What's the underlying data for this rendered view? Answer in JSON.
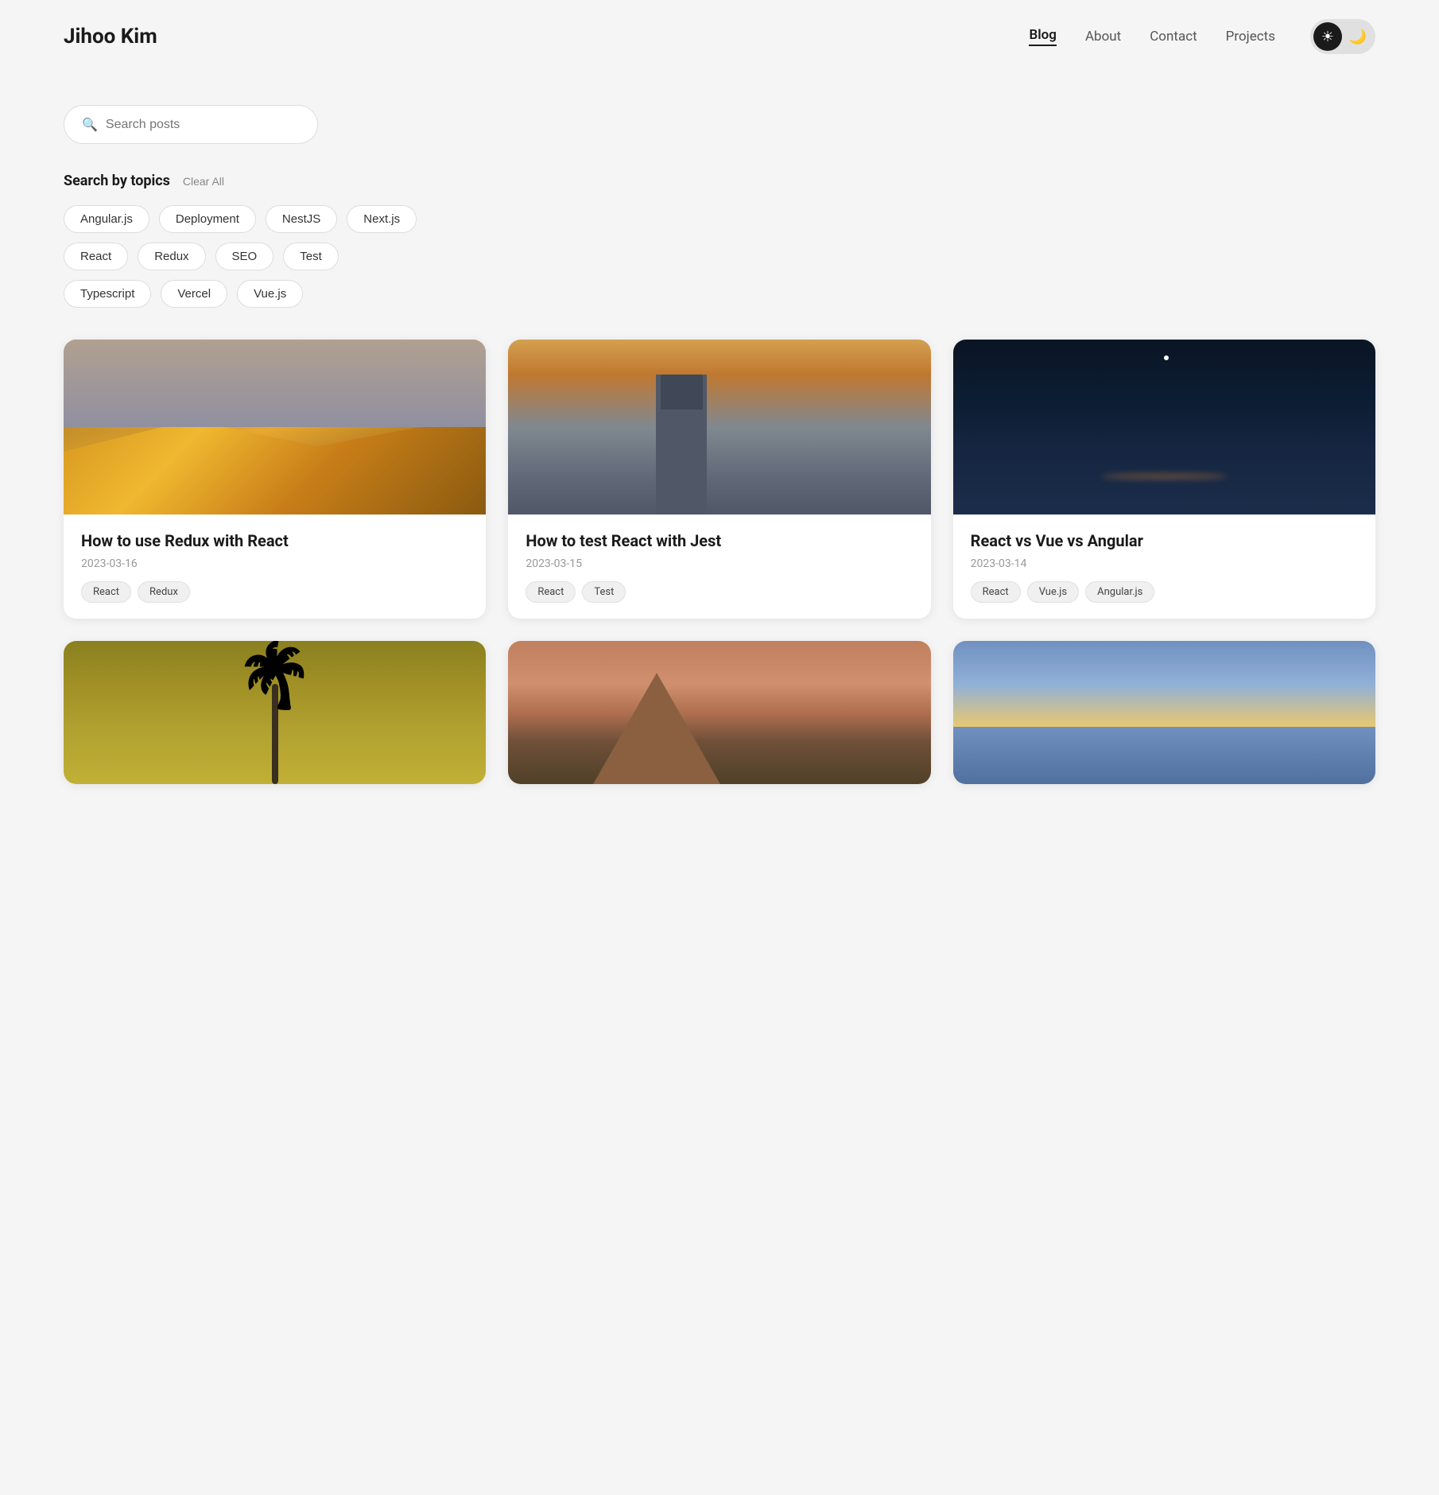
{
  "site": {
    "title": "Jihoo Kim"
  },
  "nav": {
    "links": [
      {
        "label": "Blog",
        "active": true
      },
      {
        "label": "About",
        "active": false
      },
      {
        "label": "Contact",
        "active": false
      },
      {
        "label": "Projects",
        "active": false
      }
    ],
    "theme_light_icon": "☀",
    "theme_dark_icon": "🌙"
  },
  "search": {
    "placeholder": "Search posts"
  },
  "topics": {
    "title": "Search by topics",
    "clear_label": "Clear All",
    "tags": [
      "Angular.js",
      "Deployment",
      "NestJS",
      "Next.js",
      "React",
      "Redux",
      "SEO",
      "Test",
      "Typescript",
      "Vercel",
      "Vue.js"
    ]
  },
  "posts": [
    {
      "title": "How to use Redux with React",
      "date": "2023-03-16",
      "tags": [
        "React",
        "Redux"
      ],
      "image_type": "desert"
    },
    {
      "title": "How to test React with Jest",
      "date": "2023-03-15",
      "tags": [
        "React",
        "Test"
      ],
      "image_type": "london"
    },
    {
      "title": "React vs Vue vs Angular",
      "date": "2023-03-14",
      "tags": [
        "React",
        "Vue.js",
        "Angular.js"
      ],
      "image_type": "night"
    },
    {
      "title": "",
      "date": "",
      "tags": [],
      "image_type": "palm"
    },
    {
      "title": "",
      "date": "",
      "tags": [],
      "image_type": "mountain"
    },
    {
      "title": "",
      "date": "",
      "tags": [],
      "image_type": "beach"
    }
  ]
}
